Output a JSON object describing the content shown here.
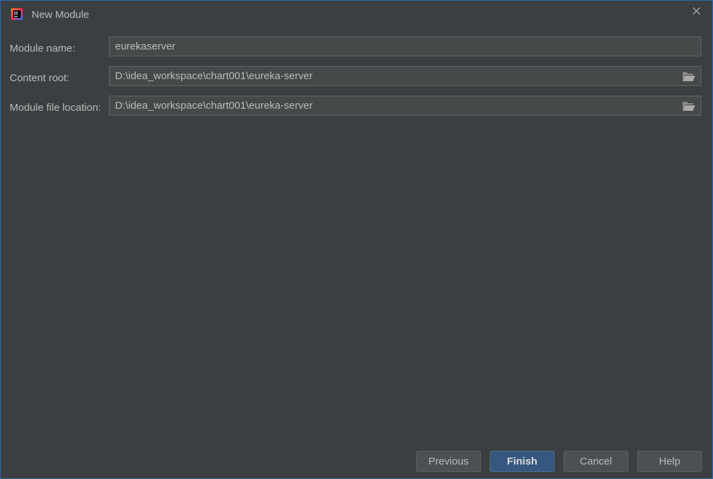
{
  "window": {
    "title": "New Module"
  },
  "form": {
    "module_name": {
      "label": "Module name:",
      "value": "eurekaserver"
    },
    "content_root": {
      "label": "Content root:",
      "value": "D:\\idea_workspace\\chart001\\eureka-server"
    },
    "module_file_location": {
      "label": "Module file location:",
      "value": "D:\\idea_workspace\\chart001\\eureka-server"
    }
  },
  "buttons": {
    "previous": "Previous",
    "finish": "Finish",
    "cancel": "Cancel",
    "help": "Help"
  },
  "icons": {
    "app": "intellij-idea-icon",
    "close": "close-icon",
    "browse": "folder-open-icon"
  },
  "colors": {
    "background": "#3c3f41",
    "field": "#45494a",
    "primary_button": "#365880"
  }
}
